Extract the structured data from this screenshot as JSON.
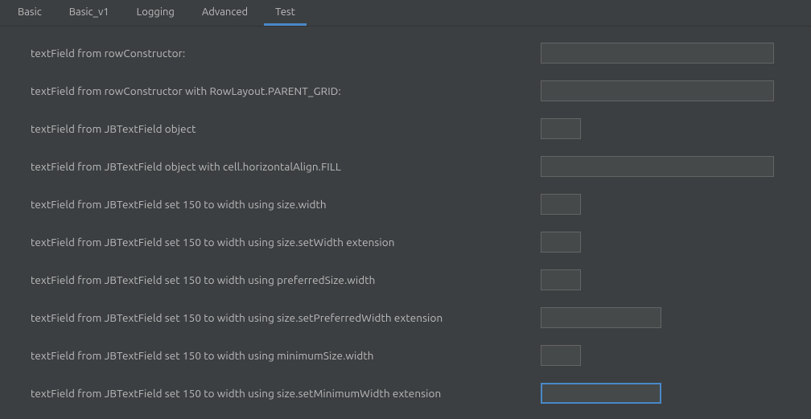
{
  "tabs": [
    {
      "label": "Basic",
      "active": false
    },
    {
      "label": "Basic_v1",
      "active": false
    },
    {
      "label": "Logging",
      "active": false
    },
    {
      "label": "Advanced",
      "active": false
    },
    {
      "label": "Test",
      "active": true
    }
  ],
  "rows": [
    {
      "label": "textField from rowConstructor:",
      "fieldClass": "full",
      "value": "",
      "focused": false
    },
    {
      "label": "textField from rowConstructor with RowLayout.PARENT_GRID:",
      "fieldClass": "full",
      "value": "",
      "focused": false
    },
    {
      "label": "textField from JBTextField object",
      "fieldClass": "small",
      "value": "",
      "focused": false
    },
    {
      "label": "textField from JBTextField object with cell.horizontalAlign.FILL",
      "fieldClass": "full",
      "value": "",
      "focused": false
    },
    {
      "label": "textField from JBTextField set 150 to width using size.width",
      "fieldClass": "small",
      "value": "",
      "focused": false
    },
    {
      "label": "textField from JBTextField set 150 to width using size.setWidth extension",
      "fieldClass": "small",
      "value": "",
      "focused": false
    },
    {
      "label": "textField from JBTextField set 150 to width using preferredSize.width",
      "fieldClass": "small",
      "value": "",
      "focused": false
    },
    {
      "label": "textField from JBTextField set 150 to width using size.setPreferredWidth extension",
      "fieldClass": "w150",
      "value": "",
      "focused": false
    },
    {
      "label": "textField from JBTextField set 150 to width using minimumSize.width",
      "fieldClass": "small",
      "value": "",
      "focused": false
    },
    {
      "label": "textField from JBTextField set 150 to width using size.setMinimumWidth extension",
      "fieldClass": "w150",
      "value": "",
      "focused": true
    }
  ]
}
